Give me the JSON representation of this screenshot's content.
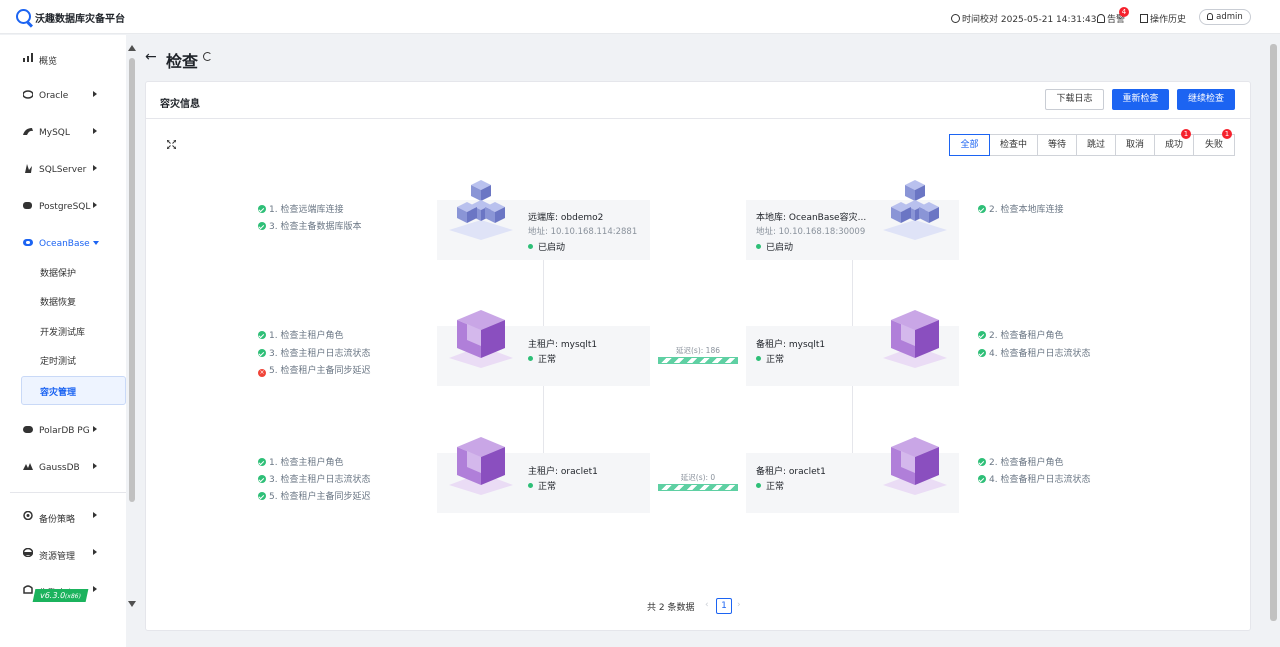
{
  "app": {
    "title": "沃趣数据库灾备平台"
  },
  "topbar": {
    "time_label": "时间校对 2025-05-21 14:31:43",
    "alert_label": "告警",
    "alert_count": "4",
    "history_label": "操作历史",
    "user": "admin"
  },
  "sidebar": {
    "items": [
      {
        "label": "概览",
        "icon": "bar-chart-icon"
      },
      {
        "label": "Oracle",
        "icon": "database-icon"
      },
      {
        "label": "MySQL",
        "icon": "dolphin-icon"
      },
      {
        "label": "SQLServer",
        "icon": "sqlserver-icon"
      },
      {
        "label": "PostgreSQL",
        "icon": "elephant-icon"
      },
      {
        "label": "OceanBase",
        "icon": "oceanbase-icon"
      },
      {
        "label": "PolarDB PG",
        "icon": "polardb-icon"
      },
      {
        "label": "GaussDB",
        "icon": "gaussdb-icon"
      },
      {
        "label": "备份策略",
        "icon": "strategy-icon"
      },
      {
        "label": "资源管理",
        "icon": "resource-icon"
      },
      {
        "label": "告警中心",
        "icon": "alarm-icon"
      }
    ],
    "oceanbase_sub": [
      "数据保护",
      "数据恢复",
      "开发测试库",
      "定时测试",
      "容灾管理"
    ],
    "version": "v6.3.0",
    "version_arch": "(x86)"
  },
  "page": {
    "title": "检查"
  },
  "card": {
    "title": "容灾信息",
    "buttons": {
      "download": "下载日志",
      "recheck": "重新检查",
      "continue": "继续检查"
    },
    "filters": [
      {
        "label": "全部",
        "badge": ""
      },
      {
        "label": "检查中",
        "badge": ""
      },
      {
        "label": "等待",
        "badge": ""
      },
      {
        "label": "跳过",
        "badge": ""
      },
      {
        "label": "取消",
        "badge": ""
      },
      {
        "label": "成功",
        "badge": "1"
      },
      {
        "label": "失败",
        "badge": "1"
      }
    ]
  },
  "topology": {
    "db_row": {
      "left_checks": [
        {
          "text": "1. 检查远端库连接",
          "status": "ok"
        },
        {
          "text": "3. 检查主备数据库版本",
          "status": "ok"
        }
      ],
      "right_checks": [
        {
          "text": "2. 检查本地库连接",
          "status": "ok"
        }
      ],
      "remote": {
        "name": "远端库: obdemo2",
        "addr": "地址: 10.10.168.114:2881",
        "status": "已启动"
      },
      "local": {
        "name": "本地库: OceanBase容灾...",
        "addr": "地址: 10.10.168.18:30009",
        "status": "已启动"
      }
    },
    "tenants": [
      {
        "left_checks": [
          {
            "text": "1. 检查主租户角色",
            "status": "ok"
          },
          {
            "text": "3. 检查主租户日志流状态",
            "status": "ok"
          },
          {
            "text": "5. 检查租户主备同步延迟",
            "status": "error"
          }
        ],
        "right_checks": [
          {
            "text": "2. 检查备租户角色",
            "status": "ok"
          },
          {
            "text": "4. 检查备租户日志流状态",
            "status": "ok"
          }
        ],
        "primary": {
          "name": "主租户: mysqlt1",
          "status": "正常"
        },
        "standby": {
          "name": "备租户: mysqlt1",
          "status": "正常"
        },
        "delay": "延迟(s): 186"
      },
      {
        "left_checks": [
          {
            "text": "1. 检查主租户角色",
            "status": "ok"
          },
          {
            "text": "3. 检查主租户日志流状态",
            "status": "ok"
          },
          {
            "text": "5. 检查租户主备同步延迟",
            "status": "ok"
          }
        ],
        "right_checks": [
          {
            "text": "2. 检查备租户角色",
            "status": "ok"
          },
          {
            "text": "4. 检查备租户日志流状态",
            "status": "ok"
          }
        ],
        "primary": {
          "name": "主租户: oraclet1",
          "status": "正常"
        },
        "standby": {
          "name": "备租户: oraclet1",
          "status": "正常"
        },
        "delay": "延迟(s): 0"
      }
    ]
  },
  "pagination": {
    "total_label": "共 2 条数据",
    "current": "1"
  },
  "colors": {
    "primary": "#1c64f2",
    "success": "#2ebf77",
    "error": "#f04438",
    "cube": "#8a95d6",
    "tenant": "#9a5fc9"
  }
}
